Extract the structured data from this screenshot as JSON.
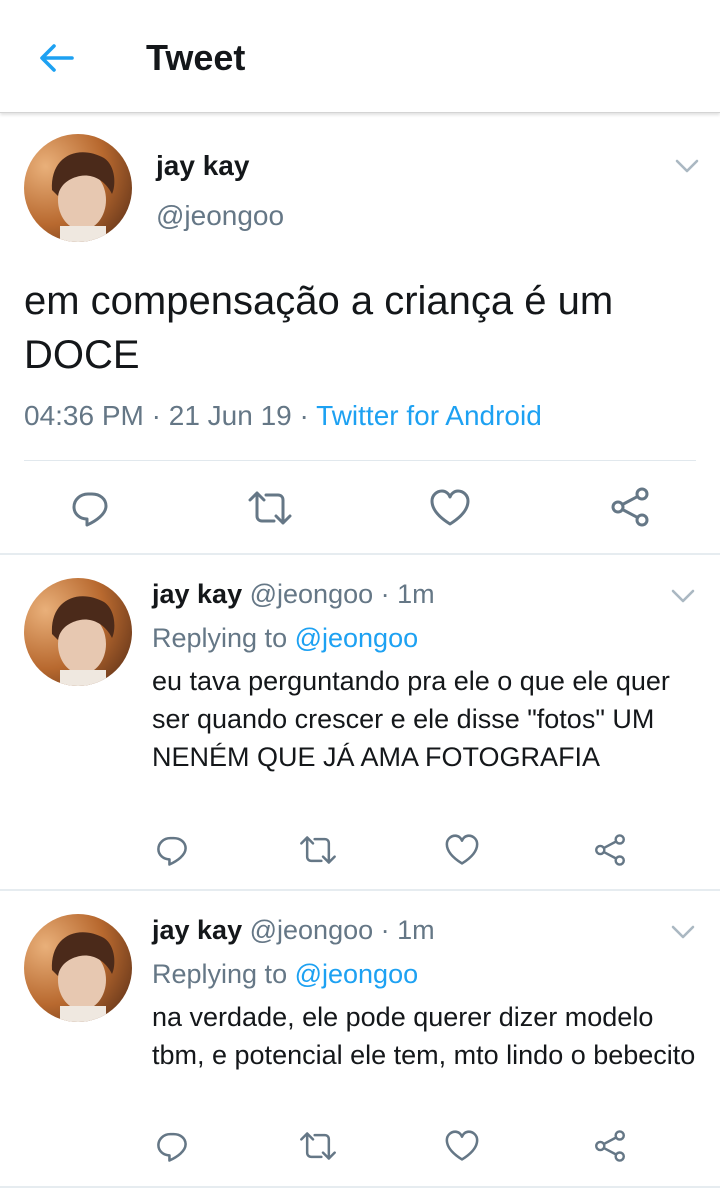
{
  "header": {
    "title": "Tweet"
  },
  "main_tweet": {
    "name": "jay kay",
    "handle": "@jeongoo",
    "text": "em compensação a criança é um DOCE",
    "time": "04:36 PM",
    "date": "21 Jun 19",
    "separator": " · ",
    "source": "Twitter for Android"
  },
  "replies": [
    {
      "name": "jay kay",
      "handle": "@jeongoo",
      "age": "1m",
      "dot": " · ",
      "replying_prefix": "Replying to ",
      "replying_to": "@jeongoo",
      "text": "eu tava perguntando pra ele o que ele quer ser quando crescer e ele disse \"fotos\" UM NENÉM QUE JÁ AMA FOTOGRAFIA"
    },
    {
      "name": "jay kay",
      "handle": "@jeongoo",
      "age": "1m",
      "dot": " · ",
      "replying_prefix": "Replying to ",
      "replying_to": "@jeongoo",
      "text": "na verdade, ele pode querer dizer modelo tbm, e potencial ele tem, mto lindo o bebecito"
    }
  ],
  "icons": {
    "back": "arrow-left-icon",
    "caret": "chevron-down-icon",
    "reply": "reply-bubble-icon",
    "retweet": "retweet-icon",
    "like": "heart-icon",
    "share": "share-icon"
  },
  "colors": {
    "accent": "#1da1f2",
    "secondary_text": "#657786",
    "icon_gray": "#657786"
  }
}
